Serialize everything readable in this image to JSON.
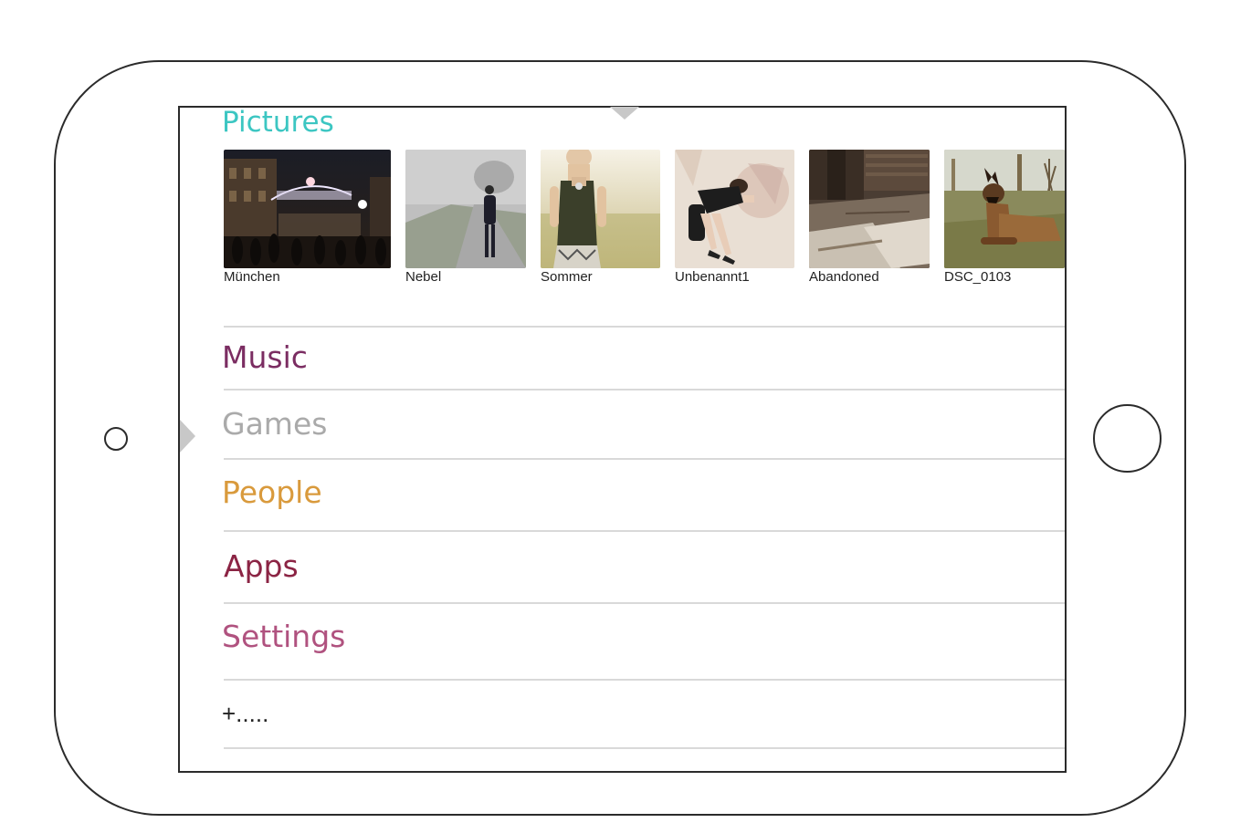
{
  "pictures": {
    "title": "Pictures",
    "items": [
      {
        "label": "München"
      },
      {
        "label": "Nebel"
      },
      {
        "label": "Sommer"
      },
      {
        "label": "Unbenannt1"
      },
      {
        "label": "Abandoned"
      },
      {
        "label": "DSC_0103"
      }
    ]
  },
  "menu": {
    "music": {
      "label": "Music",
      "color": "#7b2d62"
    },
    "games": {
      "label": "Games",
      "color": "#aaaaaa"
    },
    "people": {
      "label": "People",
      "color": "#d99a3c"
    },
    "apps": {
      "label": "Apps",
      "color": "#8b2444"
    },
    "settings": {
      "label": "Settings",
      "color": "#b0527f"
    },
    "add": {
      "label": "+....."
    }
  },
  "colors": {
    "pictures_accent": "#3cc6c2",
    "frame": "#2b2b2b",
    "divider": "#d9d9d9"
  }
}
